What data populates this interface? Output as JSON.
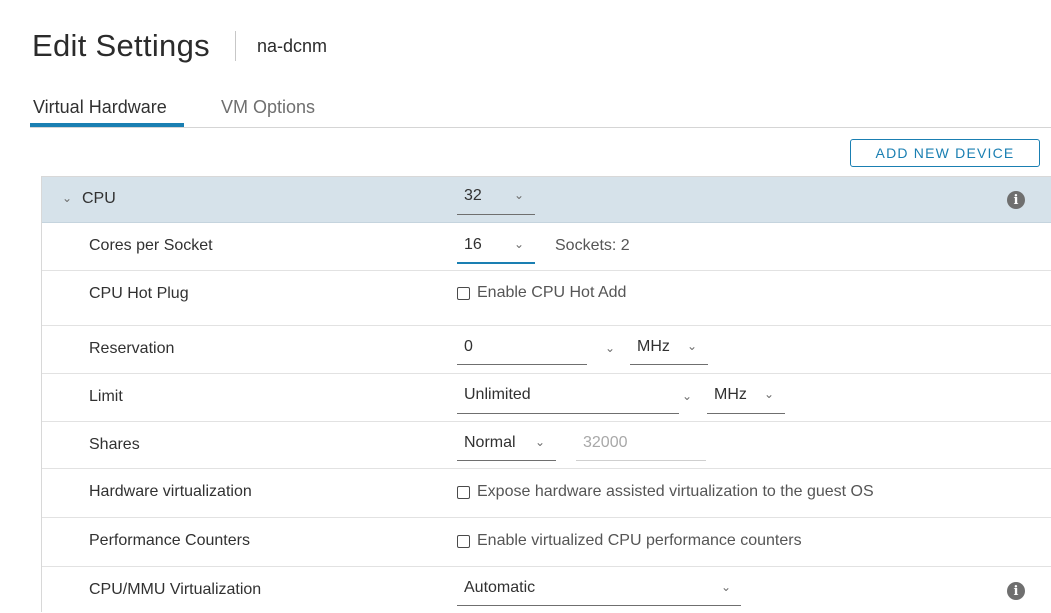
{
  "header": {
    "title": "Edit Settings",
    "vm_name": "na-dcnm"
  },
  "tabs": [
    {
      "label": "Virtual Hardware",
      "active": true
    },
    {
      "label": "VM Options",
      "active": false
    }
  ],
  "toolbar": {
    "add_device_label": "ADD NEW DEVICE"
  },
  "cpu": {
    "section_label": "CPU",
    "count": "32",
    "cores_per_socket": {
      "label": "Cores per Socket",
      "value": "16",
      "sockets_text": "Sockets: 2"
    },
    "hot_plug": {
      "label": "CPU Hot Plug",
      "checkbox_label": "Enable CPU Hot Add",
      "checked": false
    },
    "reservation": {
      "label": "Reservation",
      "value": "0",
      "unit": "MHz"
    },
    "limit": {
      "label": "Limit",
      "value": "Unlimited",
      "unit": "MHz"
    },
    "shares": {
      "label": "Shares",
      "level": "Normal",
      "value": "32000"
    },
    "hw_virtualization": {
      "label": "Hardware virtualization",
      "checkbox_label": "Expose hardware assisted virtualization to the guest OS",
      "checked": false
    },
    "perf_counters": {
      "label": "Performance Counters",
      "checkbox_label": "Enable virtualized CPU performance counters",
      "checked": false
    },
    "mmu_virtualization": {
      "label": "CPU/MMU Virtualization",
      "value": "Automatic"
    }
  },
  "colors": {
    "accent": "#1a7fb2",
    "header_row_bg": "#d6e2ea"
  }
}
